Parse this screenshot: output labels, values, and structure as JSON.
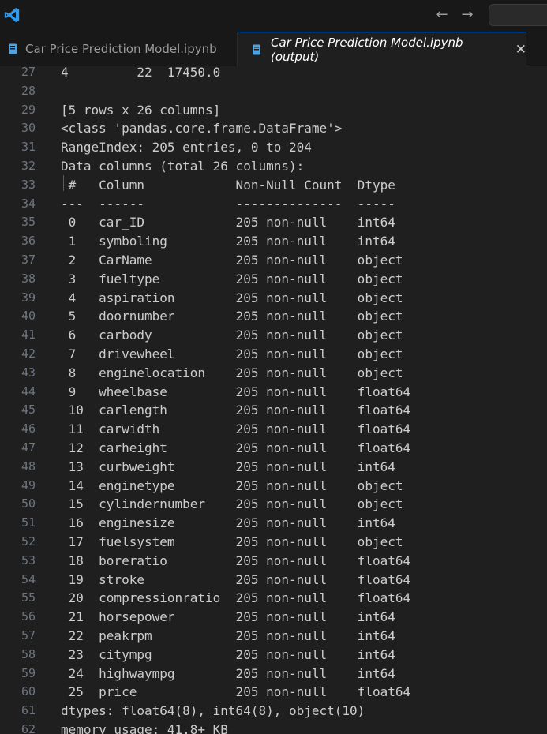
{
  "tabs": [
    {
      "label": "Car Price Prediction Model.ipynb",
      "active": false
    },
    {
      "label": "Car Price Prediction Model.ipynb (output)",
      "active": true
    }
  ],
  "icons": {
    "app": "vscode-logo-icon",
    "back": "arrow-left-icon",
    "forward": "arrow-right-icon",
    "file": "notebook-file-icon",
    "close": "close-icon"
  },
  "colors": {
    "accent": "#0078d4",
    "background": "#1f1f1f",
    "text": "#cccccc",
    "line_number": "#6e7681"
  },
  "output": {
    "first_line_number": 27,
    "lines": [
      "4         22  17450.0",
      "",
      "[5 rows x 26 columns]",
      "<class 'pandas.core.frame.DataFrame'>",
      "RangeIndex: 205 entries, 0 to 204",
      "Data columns (total 26 columns):",
      " #   Column            Non-Null Count  Dtype  ",
      "---  ------            --------------  -----  ",
      " 0   car_ID            205 non-null    int64  ",
      " 1   symboling         205 non-null    int64  ",
      " 2   CarName           205 non-null    object ",
      " 3   fueltype          205 non-null    object ",
      " 4   aspiration        205 non-null    object ",
      " 5   doornumber        205 non-null    object ",
      " 6   carbody           205 non-null    object ",
      " 7   drivewheel        205 non-null    object ",
      " 8   enginelocation    205 non-null    object ",
      " 9   wheelbase         205 non-null    float64",
      " 10  carlength         205 non-null    float64",
      " 11  carwidth          205 non-null    float64",
      " 12  carheight         205 non-null    float64",
      " 13  curbweight        205 non-null    int64  ",
      " 14  enginetype        205 non-null    object ",
      " 15  cylindernumber    205 non-null    object ",
      " 16  enginesize        205 non-null    int64  ",
      " 17  fuelsystem        205 non-null    object ",
      " 18  boreratio         205 non-null    float64",
      " 19  stroke            205 non-null    float64",
      " 20  compressionratio  205 non-null    float64",
      " 21  horsepower        205 non-null    int64  ",
      " 22  peakrpm           205 non-null    int64  ",
      " 23  citympg           205 non-null    int64  ",
      " 24  highwaympg        205 non-null    int64  ",
      " 25  price             205 non-null    float64",
      "dtypes: float64(8), int64(8), object(10)",
      "memory usage: 41.8+ KB"
    ]
  }
}
